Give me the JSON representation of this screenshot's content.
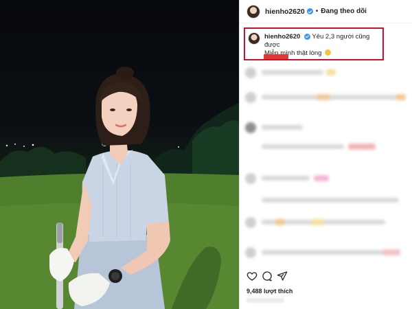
{
  "post": {
    "username": "hienho2620",
    "header_separator": "•",
    "follow_status": "Đang theo dõi",
    "caption_line1": "Yêu 2,3 người cũng được",
    "caption_line2": "Miễn mình thật lòng",
    "likes_text": "9,488 lượt thích"
  },
  "icons": {
    "like": "heart-icon",
    "comment": "comment-icon",
    "share": "share-icon",
    "verified": "verified-badge-icon",
    "caption_emoji": "smiling-face-emoji"
  },
  "colors": {
    "highlight_border": "#c8102e",
    "verified_blue": "#3897f0",
    "grass_green": "#5c8a33"
  }
}
